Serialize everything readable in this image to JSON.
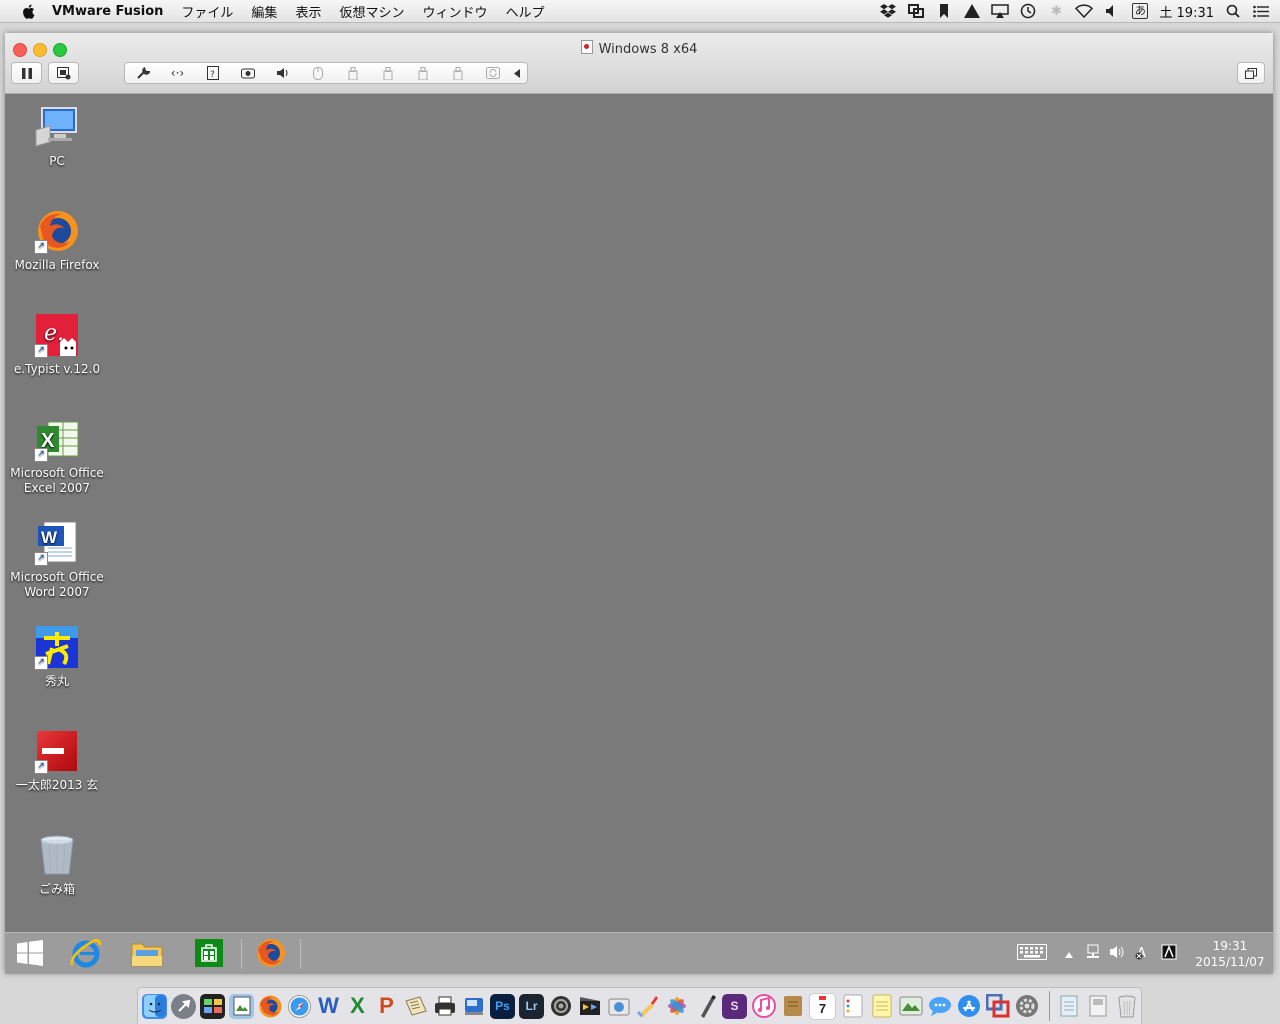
{
  "menubar": {
    "apple_glyph": "",
    "app_name": "VMware Fusion",
    "menus": [
      "ファイル",
      "編集",
      "表示",
      "仮想マシン",
      "ウィンドウ",
      "ヘルプ"
    ],
    "ime_label": "あ",
    "clock": "土 19:31"
  },
  "window": {
    "title": "Windows 8 x64"
  },
  "desktop": {
    "icons": [
      {
        "label": "PC"
      },
      {
        "label": "Mozilla Firefox"
      },
      {
        "label": "e.Typist v.12.0"
      },
      {
        "label": "Microsoft Office Excel 2007"
      },
      {
        "label": "Microsoft Office Word 2007"
      },
      {
        "label": "秀丸"
      },
      {
        "label": "一太郎2013 玄"
      },
      {
        "label": "ごみ箱"
      }
    ]
  },
  "taskbar": {
    "time": "19:31",
    "date": "2015/11/07"
  },
  "dock": {
    "items": [
      "W",
      "X",
      "P",
      "Ps",
      "Lr",
      "S"
    ],
    "calendar_day": "7"
  },
  "colors": {
    "desktop_bg": "#7a7a7a",
    "taskbar_bg": "#9c9c9c",
    "close": "#fc5f57",
    "minimize": "#fdbc2e",
    "maximize": "#28c840"
  }
}
